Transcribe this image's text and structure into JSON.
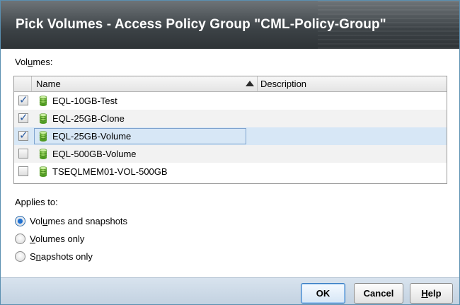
{
  "dialog": {
    "title": "Pick Volumes - Access Policy Group \"CML-Policy-Group\""
  },
  "volumes_section": {
    "label": "Volumes:",
    "label_parts": [
      "Vol",
      "u",
      "mes:"
    ]
  },
  "table": {
    "columns": [
      "Name",
      "Description"
    ],
    "sort": "ascending",
    "rows": [
      {
        "name": "EQL-10GB-Test",
        "description": "",
        "checked": true
      },
      {
        "name": "EQL-25GB-Clone",
        "description": "",
        "checked": true
      },
      {
        "name": "EQL-25GB-Volume",
        "description": "",
        "checked": true,
        "selected": true
      },
      {
        "name": "EQL-500GB-Volume",
        "description": "",
        "checked": false
      },
      {
        "name": "TSEQLMEM01-VOL-500GB",
        "description": "",
        "checked": false
      }
    ]
  },
  "applies_to": {
    "label": "Applies to:",
    "options": [
      {
        "label": "Volumes and snapshots",
        "pre": "Vol",
        "u": "u",
        "post": "mes and snapshots",
        "selected": true
      },
      {
        "label": "Volumes only",
        "pre": "",
        "u": "V",
        "post": "olumes only",
        "selected": false
      },
      {
        "label": "Snapshots only",
        "pre": "S",
        "u": "n",
        "post": "apshots only",
        "selected": false
      }
    ]
  },
  "buttons": {
    "ok": "OK",
    "cancel": "Cancel",
    "help": "Help",
    "help_u": "H",
    "help_rest": "elp"
  },
  "colors": {
    "title_bg": "#3c4246",
    "selected_row": "#d7e7f6",
    "footer_bg": "#c8d6e4",
    "db_icon_green": "#7cc243"
  }
}
